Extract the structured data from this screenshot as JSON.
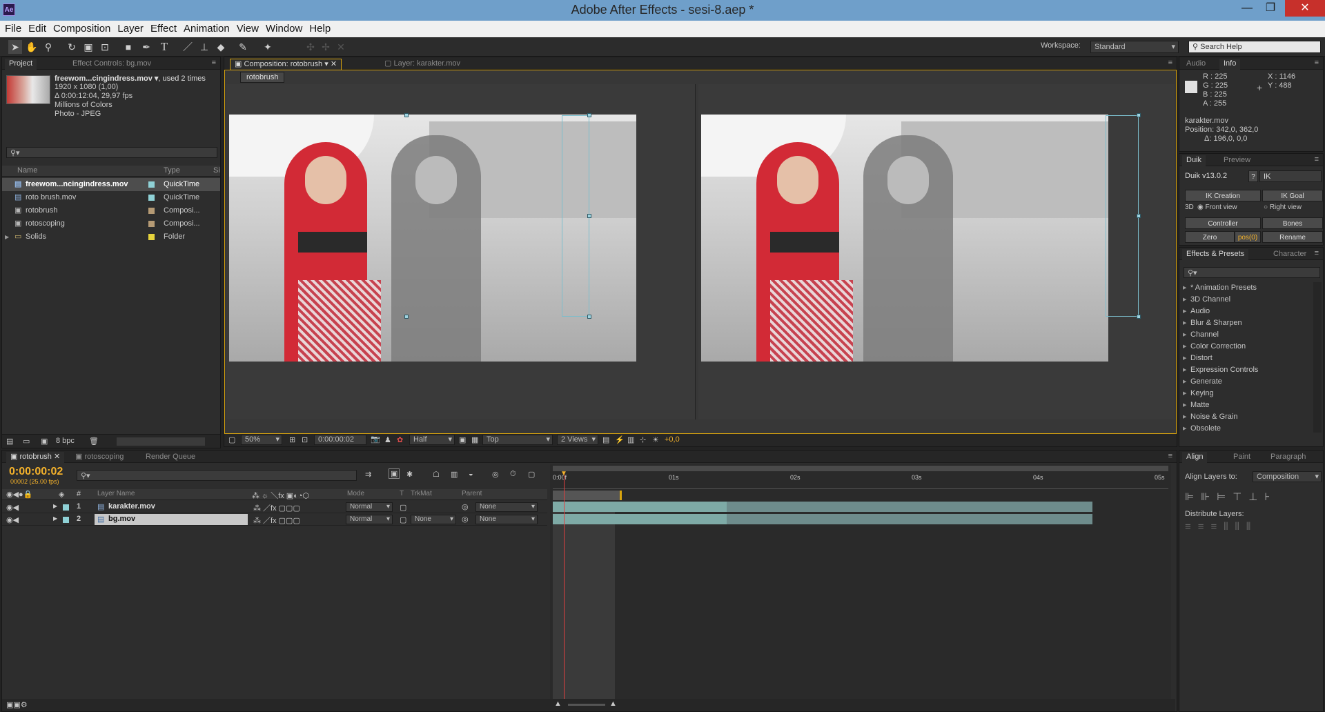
{
  "window": {
    "title": "Adobe After Effects - sesi-8.aep *",
    "app_badge": "Ae",
    "minimize": "—",
    "maximize": "❐",
    "close": "✕"
  },
  "menu": [
    "File",
    "Edit",
    "Composition",
    "Layer",
    "Effect",
    "Animation",
    "View",
    "Window",
    "Help"
  ],
  "toolbar": {
    "workspace_label": "Workspace:",
    "workspace_value": "Standard",
    "search_placeholder": "Search Help"
  },
  "project": {
    "tabs": [
      "Project",
      "Effect Controls: bg.mov"
    ],
    "thumb_name": "freewom...cingindress.mov ▾",
    "thumb_used": ", used 2 times",
    "thumb_lines": [
      "1920 x 1080 (1,00)",
      "Δ 0:00:12:04, 29,97 fps",
      "Millions of Colors",
      "Photo - JPEG"
    ],
    "cols": {
      "name": "Name",
      "type": "Type",
      "size": "Si"
    },
    "items": [
      {
        "name": "freewom...ncingindress.mov",
        "type": "QuickTime",
        "color": "#8fd1d6"
      },
      {
        "name": "roto brush.mov",
        "type": "QuickTime",
        "color": "#8fd1d6"
      },
      {
        "name": "rotobrush",
        "type": "Composi...",
        "color": "#b59a74"
      },
      {
        "name": "rotoscoping",
        "type": "Composi...",
        "color": "#b59a74"
      },
      {
        "name": "Solids",
        "type": "Folder",
        "color": "#e6d33c"
      }
    ],
    "bpc": "8 bpc"
  },
  "comp": {
    "tabs": [
      "Composition: rotobrush",
      "Layer: karakter.mov"
    ],
    "flowchart": "rotobrush",
    "zoom": "50%",
    "timecode": "0:00:00:02",
    "resolution": "Half",
    "view": "Top",
    "views": "2 Views",
    "exposure": "+0,0"
  },
  "info": {
    "tabs": [
      "Audio",
      "Info"
    ],
    "rgba": [
      "R : 225",
      "G : 225",
      "B : 225",
      "A : 255"
    ],
    "xy": [
      "X : 1146",
      "Y : 488"
    ],
    "layer": "karakter.mov",
    "position": "Position: 342,0, 362,0",
    "delta": "Δ: 196,0, 0,0"
  },
  "duik": {
    "tabs": [
      "Duik",
      "Preview"
    ],
    "version": "Duik v13.0.2",
    "help": "?",
    "field": "IK",
    "ik_creation": "IK Creation",
    "ik_goal": "IK Goal",
    "three_d": "3D",
    "front": "Front view",
    "right": "Right view",
    "controller": "Controller",
    "bones": "Bones",
    "zero": "Zero",
    "pos": "pos(0)",
    "rename": "Rename"
  },
  "effects": {
    "tabs": [
      "Effects & Presets",
      "Character"
    ],
    "items": [
      "* Animation Presets",
      "3D Channel",
      "Audio",
      "Blur & Sharpen",
      "Channel",
      "Color Correction",
      "Distort",
      "Expression Controls",
      "Generate",
      "Keying",
      "Matte",
      "Noise & Grain",
      "Obsolete"
    ]
  },
  "timeline": {
    "tabs": [
      "rotobrush",
      "rotoscoping",
      "Render Queue"
    ],
    "timecode": "0:00:00:02",
    "frames": "00002 (25.00 fps)",
    "cols": {
      "layer_name": "Layer Name",
      "mode": "Mode",
      "t": "T",
      "trkmat": "TrkMat",
      "parent": "Parent"
    },
    "layers": [
      {
        "num": "1",
        "name": "karakter.mov",
        "mode": "Normal",
        "trkmat": "",
        "parent": "None"
      },
      {
        "num": "2",
        "name": "bg.mov",
        "mode": "Normal",
        "trkmat": "None",
        "parent": "None"
      }
    ],
    "ruler": [
      "0:00f",
      "01s",
      "02s",
      "03s",
      "04s",
      "05s"
    ]
  },
  "align": {
    "tabs": [
      "Align",
      "Paint",
      "Paragraph"
    ],
    "align_to_label": "Align Layers to:",
    "align_to_value": "Composition",
    "distribute_label": "Distribute Layers:"
  }
}
